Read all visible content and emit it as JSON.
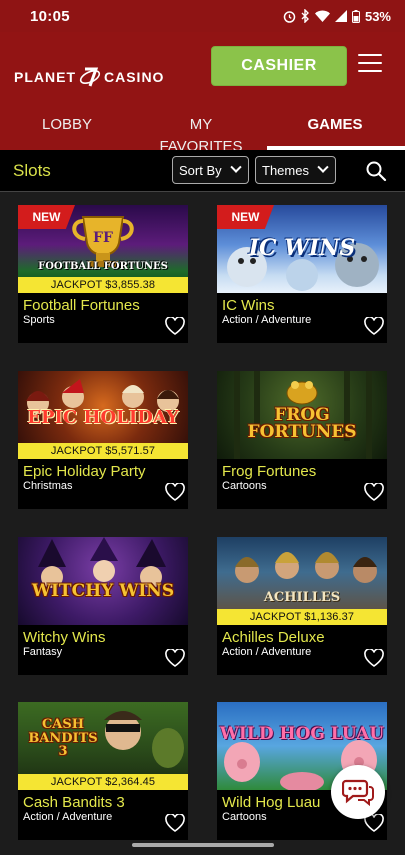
{
  "status_bar": {
    "time": "10:05",
    "battery": "53%"
  },
  "header": {
    "logo_left": "PLANET",
    "logo_right": "CASINO",
    "cashier_label": "CASHIER"
  },
  "tabs": [
    {
      "label": "LOBBY"
    },
    {
      "label": "MY FAVORITES"
    },
    {
      "label": "GAMES",
      "active": true
    }
  ],
  "filters": {
    "section_title": "Slots",
    "sort_label": "Sort By",
    "themes_label": "Themes"
  },
  "games": [
    {
      "name": "Football Fortunes",
      "category": "Sports",
      "badge": "NEW",
      "jackpot": "JACKPOT $3,855.38",
      "thumb_text": "FOOTBALL FORTUNES"
    },
    {
      "name": "IC Wins",
      "category": "Action / Adventure",
      "badge": "NEW",
      "jackpot": "",
      "thumb_text": "IC WINS"
    },
    {
      "name": "Epic Holiday Party",
      "category": "Christmas",
      "badge": "",
      "jackpot": "JACKPOT $5,571.57",
      "thumb_text": "EPIC HOLIDAY"
    },
    {
      "name": "Frog Fortunes",
      "category": "Cartoons",
      "badge": "",
      "jackpot": "",
      "thumb_text": "FROG FORTUNES"
    },
    {
      "name": "Witchy Wins",
      "category": "Fantasy",
      "badge": "",
      "jackpot": "",
      "thumb_text": "WITCHY WINS"
    },
    {
      "name": "Achilles Deluxe",
      "category": "Action / Adventure",
      "badge": "",
      "jackpot": "JACKPOT $1,136.37",
      "thumb_text": "ACHILLES"
    },
    {
      "name": "Cash Bandits 3",
      "category": "Action / Adventure",
      "badge": "",
      "jackpot": "JACKPOT $2,364.45",
      "thumb_text": "CASH BANDITS 3"
    },
    {
      "name": "Wild Hog Luau",
      "category": "Cartoons",
      "badge": "",
      "jackpot": "",
      "thumb_text": "WILD HOG LUAU"
    }
  ],
  "colors": {
    "header_red": "#921414",
    "cashier_green": "#8bc34a",
    "title_yellow": "#e3e74c",
    "jackpot_yellow": "#f5e533",
    "new_badge_red": "#d31c1c"
  }
}
